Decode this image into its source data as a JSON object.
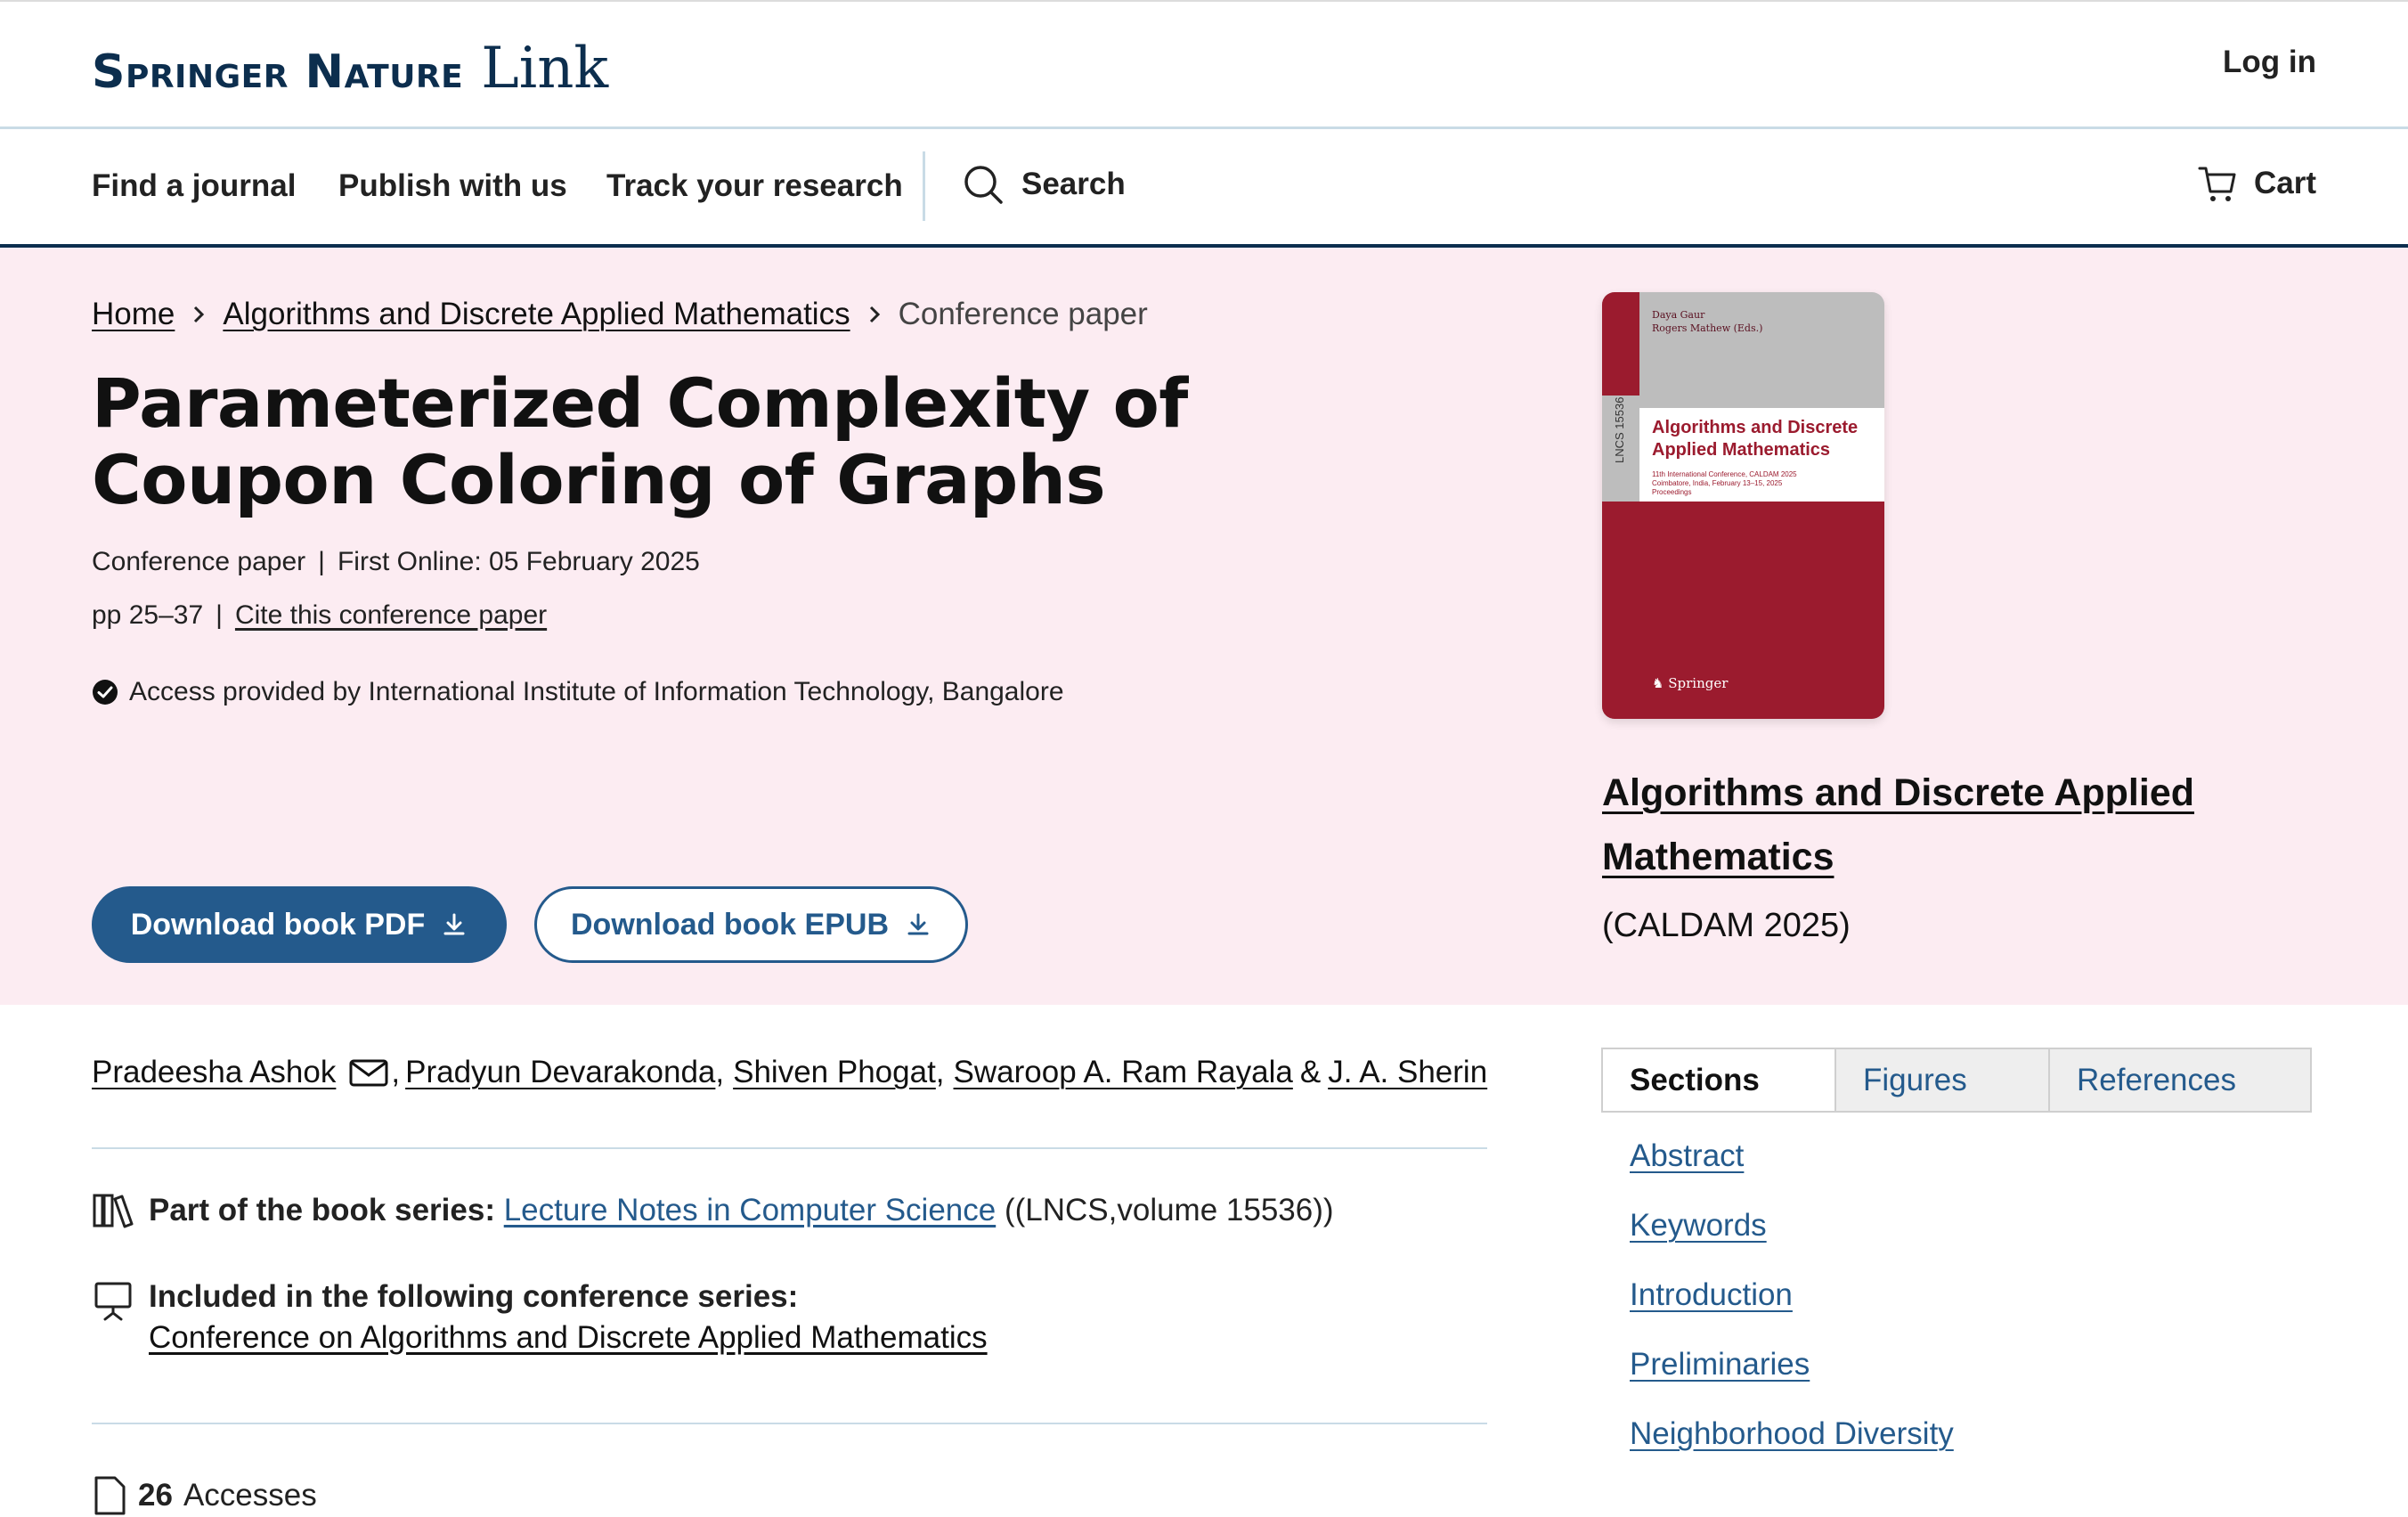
{
  "header": {
    "brand_main": "Springer Nature",
    "brand_link": "Link",
    "login_label": "Log in"
  },
  "nav": {
    "items": [
      {
        "label": "Find a journal"
      },
      {
        "label": "Publish with us"
      },
      {
        "label": "Track your research"
      }
    ],
    "search_label": "Search",
    "cart_label": "Cart"
  },
  "breadcrumb": {
    "home": "Home",
    "book": "Algorithms and Discrete Applied Mathematics",
    "current": "Conference paper"
  },
  "paper": {
    "title": "Parameterized Complexity of Coupon Coloring of Graphs",
    "type": "Conference paper",
    "first_online": "First Online: 05 February 2025",
    "pages": "pp 25–37",
    "cite_label": "Cite this conference paper",
    "access_text": "Access provided by International Institute of Information Technology, Bangalore"
  },
  "buttons": {
    "pdf_label": "Download book PDF",
    "epub_label": "Download book EPUB"
  },
  "book": {
    "title": "Algorithms and Discrete Applied Mathematics",
    "subtitle": "(CALDAM 2025)",
    "cover": {
      "editors_line1": "Daya Gaur",
      "editors_line2": "Rogers Mathew (Eds.)",
      "series_tag": "LNCS 15536",
      "title": "Algorithms and Discrete Applied Mathematics",
      "conference_line1": "11th International Conference, CALDAM 2025",
      "conference_line2": "Coimbatore, India, February 13–15, 2025",
      "conference_line3": "Proceedings",
      "publisher": "Springer"
    }
  },
  "authors": {
    "list": [
      "Pradeesha Ashok",
      "Pradyun Devarakonda",
      "Shiven Phogat",
      "Swaroop A. Ram Rayala",
      "J. A. Sherin"
    ],
    "sep_comma": ",",
    "sep_amp": "&"
  },
  "series": {
    "label": "Part of the book series:",
    "link": "Lecture Notes in Computer Science",
    "suffix": "((LNCS,volume 15536))"
  },
  "conference": {
    "label": "Included in the following conference series:",
    "link": "Conference on Algorithms and Discrete Applied Mathematics"
  },
  "metrics": {
    "accesses_count": "26",
    "accesses_label": "Accesses"
  },
  "tabs": [
    {
      "label": "Sections"
    },
    {
      "label": "Figures"
    },
    {
      "label": "References"
    }
  ],
  "sections": [
    {
      "label": "Abstract"
    },
    {
      "label": "Keywords"
    },
    {
      "label": "Introduction"
    },
    {
      "label": "Preliminaries"
    },
    {
      "label": "Neighborhood Diversity"
    }
  ],
  "colors": {
    "brand_navy": "#0c2e4e",
    "link_blue": "#245a8c",
    "hero_pink": "#fcecf2",
    "cover_red": "#9b1b2e"
  }
}
